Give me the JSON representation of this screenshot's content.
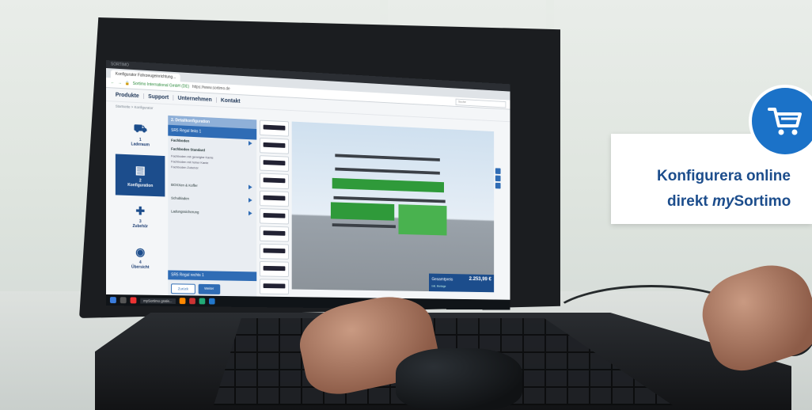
{
  "browser": {
    "window_title": "SORTIMO",
    "tab_label": "Konfigurator Fahrzeugeinrichtung...",
    "secure_label": "Sortimo International GmbH (DE)",
    "url": "https://www.sortimo.de",
    "search_placeholder": "Suche"
  },
  "site_nav": {
    "items": [
      "Produkte",
      "Support",
      "Unternehmen",
      "Kontakt"
    ]
  },
  "breadcrumb": "Startseite > Konfigurator",
  "steps": [
    {
      "number": "1",
      "label": "Laderaum",
      "icon": "van-icon"
    },
    {
      "number": "2",
      "label": "Konfiguration",
      "icon": "shelf-icon"
    },
    {
      "number": "3",
      "label": "Zubehör",
      "icon": "accessory-plus-icon"
    },
    {
      "number": "4",
      "label": "Übersicht",
      "icon": "eye-icon"
    }
  ],
  "config_panel": {
    "header": "2. Detailkonfiguration",
    "selected": "SR5 Regal links 1",
    "items": [
      {
        "label": "Fachboden",
        "bold": true,
        "expand": true
      },
      {
        "label": "Fachboden Standard",
        "bold": true,
        "expand": false
      },
      {
        "label": "Fachboden mit geneigter Kante",
        "bold": false,
        "expand": false
      },
      {
        "label": "Fachboden mit hoher Kante",
        "bold": false,
        "expand": false
      },
      {
        "label": "Fachboden Zubehör",
        "bold": false,
        "expand": false
      },
      {
        "label": "BOXXen & Koffer",
        "bold": false,
        "expand": true
      },
      {
        "label": "Schubladen",
        "bold": false,
        "expand": true
      },
      {
        "label": "Ladungssicherung",
        "bold": false,
        "expand": true
      }
    ],
    "footer": "SR5 Regal rechts 1",
    "back_label": "Zurück",
    "next_label": "Weiter"
  },
  "thumbnails": [
    "",
    "",
    "",
    "",
    "",
    "",
    "",
    "",
    "",
    ""
  ],
  "price": {
    "label": "Gesamtpreis",
    "value": "2.253,99 €",
    "sub": "inkl. Montage"
  },
  "taskbar": {
    "app_label": "mySortimo gratis..."
  },
  "callout": {
    "line1": "Konfigurera online",
    "line2_prefix": "direkt ",
    "line2_italic": "my",
    "line2_suffix": "Sortimo"
  },
  "colors": {
    "brand_blue": "#1c4d8c",
    "cart_blue": "#1b72c8",
    "shelf_green": "#2f9a3a"
  },
  "icons": {
    "cart": "cart-icon"
  }
}
